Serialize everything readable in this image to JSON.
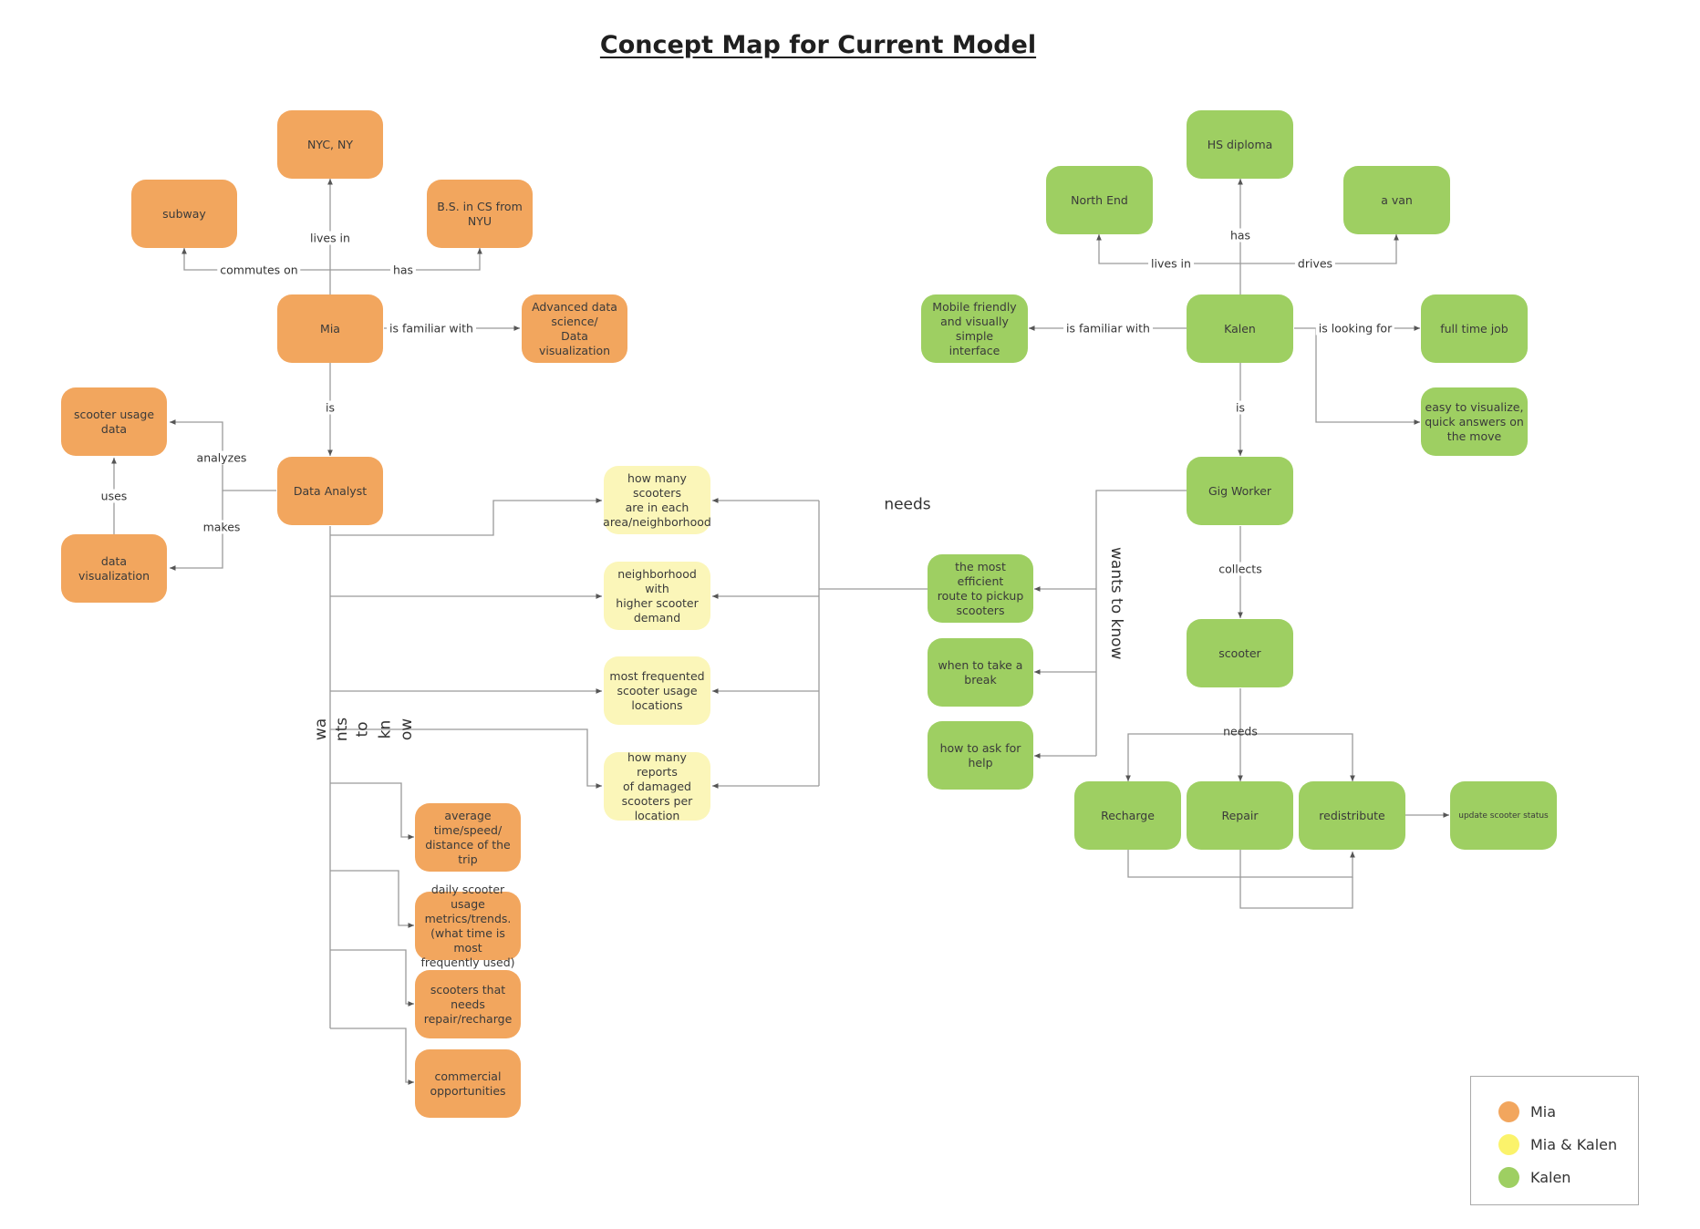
{
  "title": "Concept Map for Current Model",
  "colors": {
    "mia": "#f2a65e",
    "mia_and_kalen": "#fbf6b9",
    "kalen": "#9ecf62"
  },
  "mia_nodes": {
    "nyc": "NYC, NY",
    "subway": "subway",
    "bs_cs": "B.S. in CS from NYU",
    "mia": "Mia",
    "advanced_ds": "Advanced data\nscience/\nData visualization",
    "scooter_usage_data": "scooter usage data",
    "data_analyst": "Data Analyst",
    "data_visualization": "data visualization",
    "avg_time": "average\ntime/speed/\ndistance of the trip",
    "daily_usage": "daily scooter usage\nmetrics/trends.\n(what time is most\nfrequently used)",
    "needs_repair": "scooters that\nneeds\nrepair/recharge",
    "commercial": "commercial\nopportunities"
  },
  "shared_nodes": {
    "scooters_per_area": "how many scooters\nare in each\narea/neighborhood",
    "higher_demand": "neighborhood with\nhigher scooter\ndemand",
    "most_frequented": "most frequented\nscooter usage\nlocations",
    "damaged_reports": "how many reports\nof damaged\nscooters per\nlocation"
  },
  "kalen_nodes": {
    "hs_diploma": "HS diploma",
    "north_end": "North End",
    "van": "a van",
    "mobile_friendly": "Mobile friendly\nand visually simple\ninterface",
    "kalen": "Kalen",
    "full_time_job": "full time job",
    "easy_visualize": "easy to visualize,\nquick answers on\nthe move",
    "gig_worker": "Gig Worker",
    "efficient_route": "the most efficient\nroute to pickup\nscooters",
    "take_break": "when to take a\nbreak",
    "ask_help": "how to ask for\nhelp",
    "scooter": "scooter",
    "recharge": "Recharge",
    "repair": "Repair",
    "redistribute": "redistribute",
    "update_status": "update scooter status"
  },
  "link_labels": {
    "lives_in_mia": "lives in",
    "commutes_on": "commutes on",
    "has_mia": "has",
    "is_familiar_with_mia": "is familiar with",
    "is_mia": "is",
    "analyzes": "analyzes",
    "uses": "uses",
    "makes": "makes",
    "wants_to_know_mia": [
      "wa",
      "nts",
      "to",
      "kn",
      "ow"
    ],
    "needs_shared": "needs",
    "has_kalen": "has",
    "lives_in_kalen": "lives in",
    "drives": "drives",
    "is_familiar_with_kalen": "is familiar with",
    "is_looking_for": "is looking for",
    "is_kalen": "is",
    "wants_to_know_kalen": "wants to know",
    "collects": "collects",
    "needs_scooter": "needs"
  },
  "legend": [
    {
      "label": "Mia",
      "color": "#f2a65e"
    },
    {
      "label": "Mia & Kalen",
      "color": "#fbf6b9"
    },
    {
      "label": "Kalen",
      "color": "#9ecf62"
    }
  ]
}
